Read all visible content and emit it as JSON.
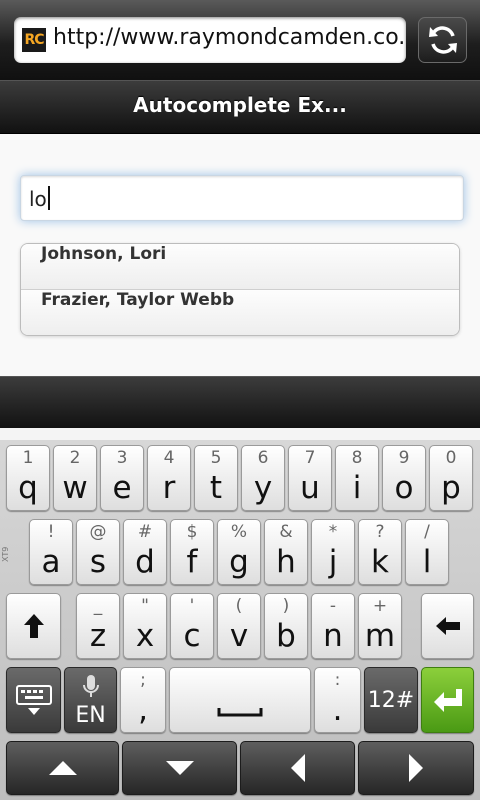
{
  "browser": {
    "favicon_text": "RC",
    "url": "http://www.raymondcamden.co..."
  },
  "header": {
    "title": "Autocomplete Ex..."
  },
  "search": {
    "value": "lo"
  },
  "suggestions": [
    "Johnson, Lori",
    "Frazier, Taylor Webb"
  ],
  "keyboard": {
    "row1": [
      {
        "p": "q",
        "s": "1"
      },
      {
        "p": "w",
        "s": "2"
      },
      {
        "p": "e",
        "s": "3"
      },
      {
        "p": "r",
        "s": "4"
      },
      {
        "p": "t",
        "s": "5"
      },
      {
        "p": "y",
        "s": "6"
      },
      {
        "p": "u",
        "s": "7"
      },
      {
        "p": "i",
        "s": "8"
      },
      {
        "p": "o",
        "s": "9"
      },
      {
        "p": "p",
        "s": "0"
      }
    ],
    "row2": [
      {
        "p": "a",
        "s": "!"
      },
      {
        "p": "s",
        "s": "@"
      },
      {
        "p": "d",
        "s": "#"
      },
      {
        "p": "f",
        "s": "$"
      },
      {
        "p": "g",
        "s": "%"
      },
      {
        "p": "h",
        "s": "&"
      },
      {
        "p": "j",
        "s": "*"
      },
      {
        "p": "k",
        "s": "?"
      },
      {
        "p": "l",
        "s": "/"
      }
    ],
    "row3": [
      {
        "p": "z",
        "s": "_"
      },
      {
        "p": "x",
        "s": "\""
      },
      {
        "p": "c",
        "s": "'"
      },
      {
        "p": "v",
        "s": "("
      },
      {
        "p": "b",
        "s": ")"
      },
      {
        "p": "n",
        "s": "-"
      },
      {
        "p": "m",
        "s": "+"
      }
    ],
    "side_label": "XT9",
    "lang_label": "EN",
    "comma": {
      "p": ",",
      "s": ";"
    },
    "period": {
      "p": ".",
      "s": ":"
    },
    "symbols_label": "12#"
  },
  "colors": {
    "accent_green": "#5aa51e",
    "focus_glow": "#9ec2e6"
  }
}
